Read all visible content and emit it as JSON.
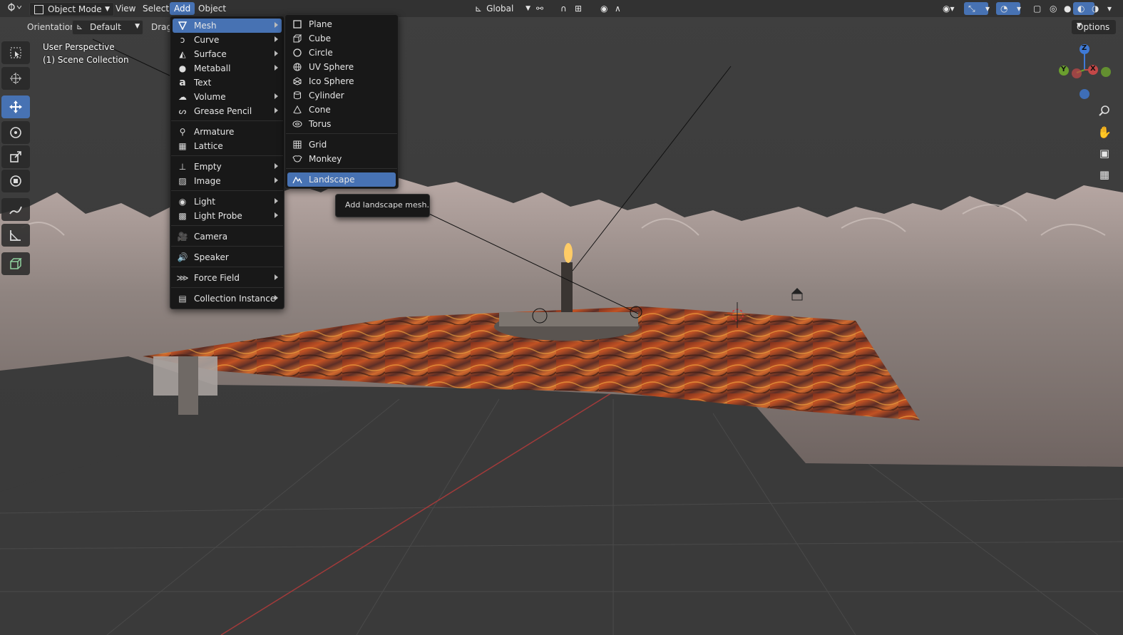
{
  "topbar": {
    "editor_type_icon": "editor-type-icon",
    "mode_label": "Object Mode",
    "menus": [
      "View",
      "Select",
      "Add",
      "Object"
    ],
    "active_menu": "Add",
    "transform_orientation": "Global"
  },
  "header2": {
    "orientation_label": "Orientation:",
    "orientation_value": "Default",
    "drag_label": "Drag:",
    "options_label": "Options"
  },
  "viewport": {
    "view_name": "User Perspective",
    "collection": "(1) Scene Collection"
  },
  "axes": {
    "z": "Z",
    "y": "Y",
    "x": "X"
  },
  "add_menu": {
    "items": [
      {
        "label": "Mesh",
        "icon": "mesh-icon",
        "submenu": true
      },
      {
        "label": "Curve",
        "icon": "curve-icon",
        "submenu": true
      },
      {
        "label": "Surface",
        "icon": "surface-icon",
        "submenu": true
      },
      {
        "label": "Metaball",
        "icon": "metaball-icon",
        "submenu": true
      },
      {
        "label": "Text",
        "icon": "text-icon",
        "submenu": false
      },
      {
        "label": "Volume",
        "icon": "volume-icon",
        "submenu": true
      },
      {
        "label": "Grease Pencil",
        "icon": "grease-pencil-icon",
        "submenu": true
      },
      {
        "label": "Armature",
        "icon": "armature-icon",
        "submenu": false
      },
      {
        "label": "Lattice",
        "icon": "lattice-icon",
        "submenu": false
      },
      {
        "label": "Empty",
        "icon": "empty-icon",
        "submenu": true
      },
      {
        "label": "Image",
        "icon": "image-icon",
        "submenu": true
      },
      {
        "label": "Light",
        "icon": "light-icon",
        "submenu": true
      },
      {
        "label": "Light Probe",
        "icon": "light-probe-icon",
        "submenu": true
      },
      {
        "label": "Camera",
        "icon": "camera-icon",
        "submenu": false
      },
      {
        "label": "Speaker",
        "icon": "speaker-icon",
        "submenu": false
      },
      {
        "label": "Force Field",
        "icon": "force-field-icon",
        "submenu": true
      },
      {
        "label": "Collection Instance",
        "icon": "collection-instance-icon",
        "submenu": true
      }
    ]
  },
  "mesh_menu": {
    "items": [
      {
        "label": "Plane",
        "icon": "plane-icon"
      },
      {
        "label": "Cube",
        "icon": "cube-icon"
      },
      {
        "label": "Circle",
        "icon": "circle-icon"
      },
      {
        "label": "UV Sphere",
        "icon": "uv-sphere-icon"
      },
      {
        "label": "Ico Sphere",
        "icon": "ico-sphere-icon"
      },
      {
        "label": "Cylinder",
        "icon": "cylinder-icon"
      },
      {
        "label": "Cone",
        "icon": "cone-icon"
      },
      {
        "label": "Torus",
        "icon": "torus-icon"
      },
      {
        "label": "Grid",
        "icon": "grid-icon"
      },
      {
        "label": "Monkey",
        "icon": "monkey-icon"
      },
      {
        "label": "Landscape",
        "icon": "landscape-icon"
      }
    ],
    "highlighted": "Landscape"
  },
  "tooltip": {
    "text": "Add landscape mesh."
  },
  "colors": {
    "accent": "#4772b3",
    "menu_bg": "#181818",
    "lava": "#c8461e",
    "axis_red": "#c44848",
    "axis_green": "#6a9e2e",
    "axis_blue": "#3f7ad6"
  }
}
